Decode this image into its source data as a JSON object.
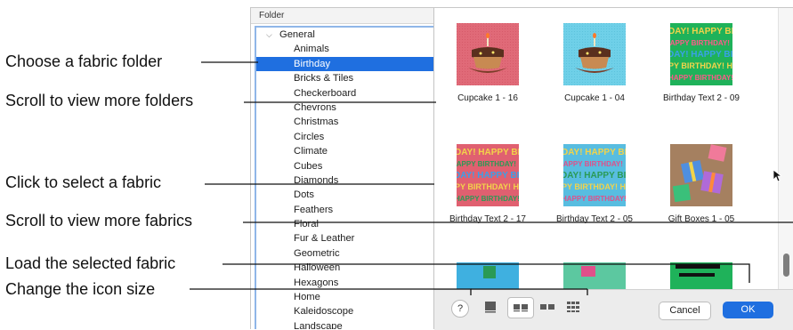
{
  "callouts": {
    "choose_folder": "Choose a fabric folder",
    "scroll_folders": "Scroll to view more folders",
    "select_fabric": "Click to select a fabric",
    "scroll_fabrics": "Scroll to view more fabrics",
    "load_fabric": "Load the selected fabric",
    "icon_size": "Change the icon size"
  },
  "folder_panel": {
    "header": "Folder",
    "root": "General",
    "items": [
      "Animals",
      "Birthday",
      "Bricks & Tiles",
      "Checkerboard",
      "Chevrons",
      "Christmas",
      "Circles",
      "Climate",
      "Cubes",
      "Diamonds",
      "Dots",
      "Feathers",
      "Floral",
      "Fur & Leather",
      "Geometric",
      "Halloween",
      "Hexagons",
      "Home",
      "Kaleidoscope",
      "Landscape"
    ],
    "selected": "Birthday"
  },
  "fabrics": [
    {
      "name": "Cupcake 1 - 16",
      "icon": "cupcake-pink"
    },
    {
      "name": "Cupcake 1 - 04",
      "icon": "cupcake-blue"
    },
    {
      "name": "Birthday Text 2 - 09",
      "icon": "birthday-text-green"
    },
    {
      "name": "Birthday Text 2 - 17",
      "icon": "birthday-text-red"
    },
    {
      "name": "Birthday Text 2 - 05",
      "icon": "birthday-text-blue"
    },
    {
      "name": "Gift Boxes 1 - 05",
      "icon": "gift-boxes"
    }
  ],
  "birthday_text": {
    "line1": "DAY! HAPPY BIRTH",
    "line2": "HAPPY BIRTHDAY!",
    "line3": "DAY! HAPPY BIRTH",
    "line4": "PPY BIRTHDAY! HAP",
    "line5": "HAPPY BIRTHDAY! HAP"
  },
  "buttons": {
    "help": "?",
    "cancel": "Cancel",
    "ok": "OK"
  },
  "colors": {
    "accent": "#1f6fe0",
    "pink_fabric": "#e06a78",
    "blue_fabric": "#6fd0e8",
    "green_fabric": "#1fb25a",
    "brown_fabric": "#a58060"
  }
}
